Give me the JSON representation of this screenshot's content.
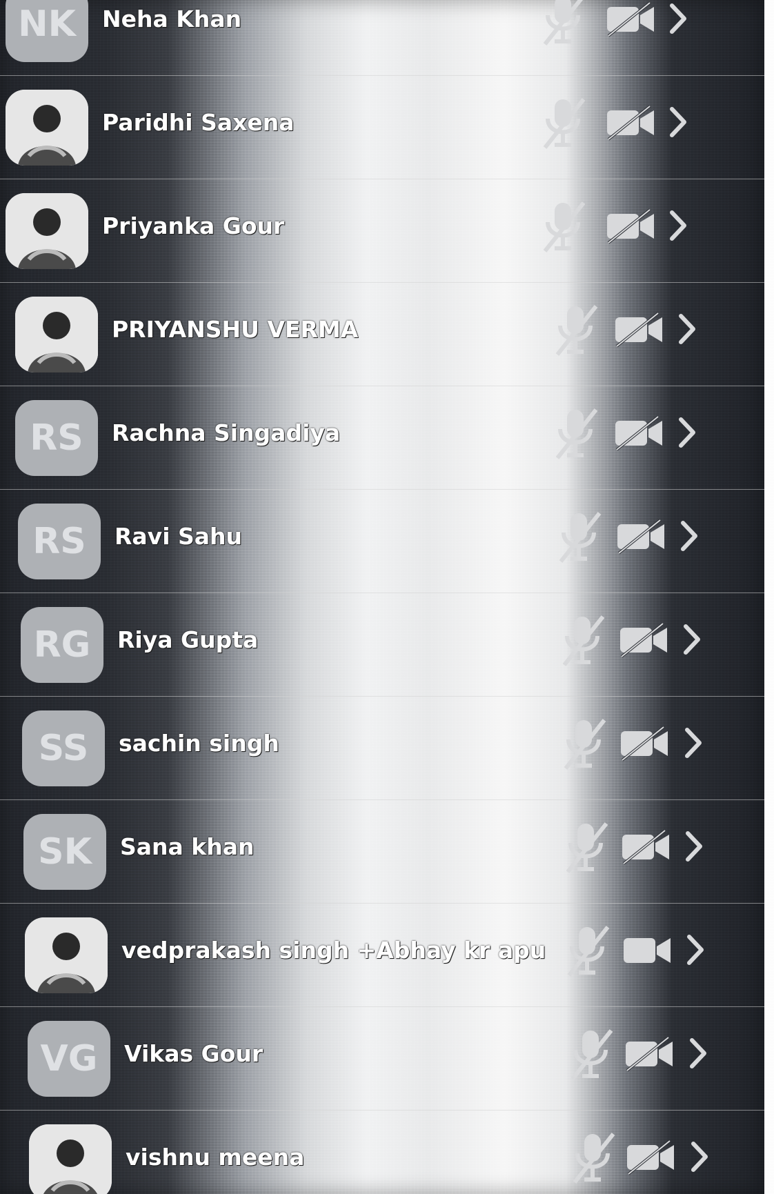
{
  "participants": [
    {
      "initials": "NK",
      "name": "Neha Khan",
      "avatar_type": "initials",
      "mic": "muted",
      "video": "off",
      "row_x": 0,
      "row_offset": 0
    },
    {
      "initials": "",
      "name": "Paridhi Saxena",
      "avatar_type": "photo",
      "mic": "muted",
      "video": "off",
      "row_x": 0,
      "row_offset": 0
    },
    {
      "initials": "",
      "name": "Priyanka Gour",
      "avatar_type": "photo",
      "mic": "muted",
      "video": "off",
      "row_x": 0,
      "row_offset": 0
    },
    {
      "initials": "",
      "name": "PRIYANSHU VERMA",
      "avatar_type": "photo",
      "mic": "muted",
      "video": "off",
      "row_x": 0,
      "row_offset": 0
    },
    {
      "initials": "RS",
      "name": "Rachna Singadiya",
      "avatar_type": "initials",
      "mic": "muted",
      "video": "off",
      "row_x": 0,
      "row_offset": 0
    },
    {
      "initials": "RS",
      "name": "Ravi Sahu",
      "avatar_type": "initials",
      "mic": "muted",
      "video": "off",
      "row_x": 0,
      "row_offset": 0
    },
    {
      "initials": "RG",
      "name": "Riya Gupta",
      "avatar_type": "initials",
      "mic": "muted",
      "video": "off",
      "row_x": 0,
      "row_offset": 0
    },
    {
      "initials": "SS",
      "name": "sachin singh",
      "avatar_type": "initials",
      "mic": "muted",
      "video": "off",
      "row_x": 0,
      "row_offset": 0
    },
    {
      "initials": "SK",
      "name": "Sana khan",
      "avatar_type": "initials",
      "mic": "muted",
      "video": "off",
      "row_x": 0,
      "row_offset": 0
    },
    {
      "initials": "",
      "name": "vedprakash singh +Abhay kr apu",
      "avatar_type": "photo",
      "mic": "muted",
      "video": "on",
      "row_x": 0,
      "row_offset": 0
    },
    {
      "initials": "VG",
      "name": "Vikas Gour",
      "avatar_type": "initials",
      "mic": "muted",
      "video": "off",
      "row_x": 0,
      "row_offset": 0
    },
    {
      "initials": "",
      "name": "vishnu meena",
      "avatar_type": "photo",
      "mic": "muted",
      "video": "off",
      "row_x": 0,
      "row_offset": 0
    }
  ],
  "icons": {
    "mic": "microphone-muted-icon",
    "cam_off": "video-camera-off-icon",
    "cam_on": "video-camera-icon",
    "chevron": "chevron-right-icon"
  },
  "colors": {
    "avatar_bg": "#aeb1b5",
    "avatar_text": "#dfe1e4",
    "name_text": "#ffffff",
    "icon": "#d8d9db"
  }
}
